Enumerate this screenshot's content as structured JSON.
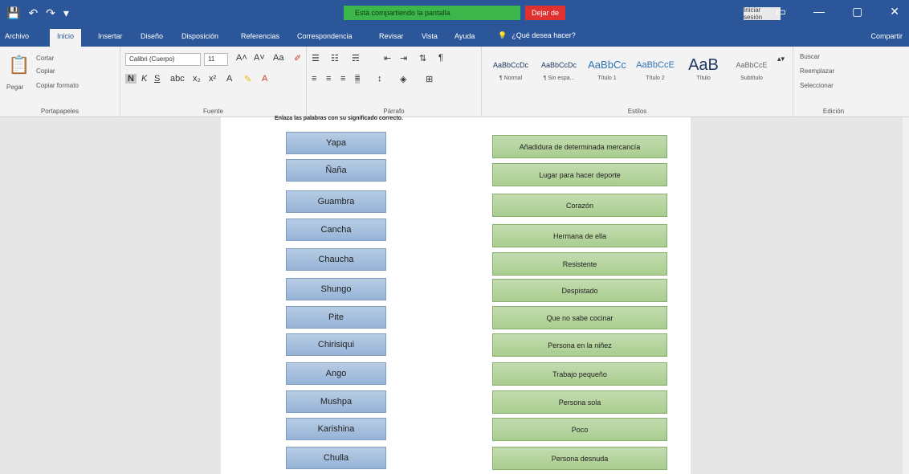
{
  "titlebar": {
    "qat": [
      "💾",
      "↶",
      "↷",
      "▾"
    ],
    "share_status": "Está compartiendo la pantalla",
    "stop_share": "Dejar de",
    "signin": "Iniciar sesión",
    "controls": [
      "▭",
      "—",
      "▢",
      "✕"
    ]
  },
  "menu": {
    "tabs": [
      "Archivo",
      "Inicio",
      "Insertar",
      "Diseño",
      "Disposición",
      "Referencias",
      "Correspondencia",
      "Revisar",
      "Vista",
      "Ayuda"
    ],
    "tell_me": "¿Qué desea hacer?",
    "share": "Compartir"
  },
  "ribbon": {
    "clipboard": {
      "paste": "Pegar",
      "cut": "Cortar",
      "copy": "Copiar",
      "format_painter": "Copiar formato",
      "label": "Portapapeles"
    },
    "font": {
      "name": "Calibri (Cuerpo)",
      "size": "11",
      "label": "Fuente"
    },
    "paragraph": {
      "label": "Párrafo"
    },
    "styles": {
      "items": [
        {
          "preview": "AaBbCcDc",
          "label": "¶ Normal"
        },
        {
          "preview": "AaBbCcDc",
          "label": "¶ Sin espa..."
        },
        {
          "preview": "AaBbCc",
          "label": "Título 1"
        },
        {
          "preview": "AaBbCcE",
          "label": "Título 2"
        },
        {
          "preview": "AaB",
          "label": "Título"
        },
        {
          "preview": "AaBbCcE",
          "label": "Subtítulo"
        }
      ],
      "label": "Estilos"
    },
    "editing": {
      "find": "Buscar",
      "replace": "Reemplazar",
      "select": "Seleccionar",
      "label": "Edición"
    }
  },
  "document": {
    "instruction": "Enlaza las palabras con su significado correcto.",
    "words": [
      "Yapa",
      "Ñaña",
      "Guambra",
      "Cancha",
      "Chaucha",
      "Shungo",
      "Pite",
      "Chirisiqui",
      "Ango",
      "Mushpa",
      "Karishina",
      "Chulla"
    ],
    "meanings": [
      "Añadidura de determinada mercancía",
      "Lugar para hacer deporte",
      "Corazón",
      "Hermana de ella",
      "Resistente",
      "Despistado",
      "Que no sabe cocinar",
      "Persona en la niñez",
      "Trabajo pequeño",
      "Persona sola",
      "Poco",
      "Persona desnuda"
    ]
  },
  "colors": {
    "word_accent": "#95b3d7",
    "meaning_accent": "#a9cd8f",
    "title_bar": "#2b579a"
  }
}
